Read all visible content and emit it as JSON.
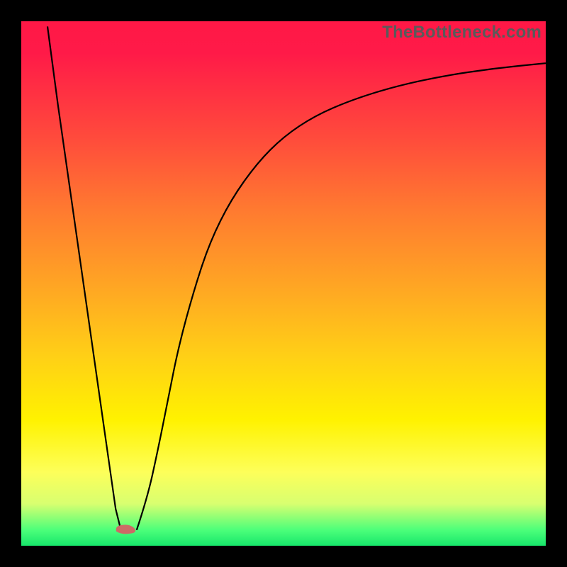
{
  "domain": "Chart",
  "attribution": "TheBottleneck.com",
  "colors": {
    "frame": "#000000",
    "gradient_top": "#ff1846",
    "gradient_mid": "#ffd016",
    "gradient_bottom": "#17e66b",
    "curve": "#000000",
    "marker": "#cc6a66"
  },
  "chart_data": {
    "type": "line",
    "title": "",
    "xlabel": "",
    "ylabel": "",
    "xlim": [
      0,
      100
    ],
    "ylim": [
      0,
      100
    ],
    "series": [
      {
        "name": "left-branch",
        "x": [
          5,
          7,
          9,
          11,
          13,
          15,
          17,
          18,
          19
        ],
        "y": [
          99,
          84,
          70,
          56,
          42,
          28,
          14,
          7,
          3
        ]
      },
      {
        "name": "right-branch",
        "x": [
          22,
          24,
          26,
          28,
          30,
          33,
          36,
          40,
          45,
          50,
          56,
          63,
          71,
          80,
          90,
          100
        ],
        "y": [
          3,
          9,
          18,
          28,
          38,
          49,
          58,
          66,
          73,
          78,
          82,
          85,
          87.5,
          89.5,
          91,
          92
        ]
      }
    ],
    "marker": {
      "x": 20,
      "y": 3,
      "shape": "blob"
    },
    "notes": "Values approximate; read from pixel positions on an unlabeled plot. y=100 is top of plot area, y=0 is bottom."
  }
}
